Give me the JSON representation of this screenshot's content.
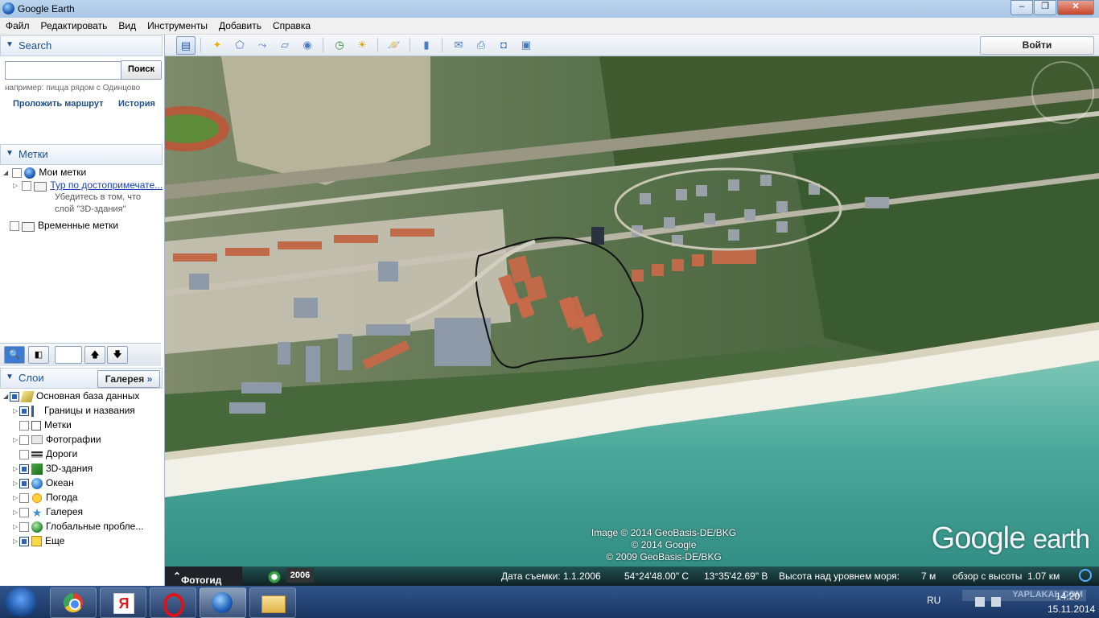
{
  "window": {
    "title": "Google Earth",
    "buttons": {
      "minimize": "–",
      "maximize": "❐",
      "close": "✕"
    }
  },
  "menu": [
    "Файл",
    "Редактировать",
    "Вид",
    "Инструменты",
    "Добавить",
    "Справка"
  ],
  "search": {
    "header": "Search",
    "button": "Поиск",
    "hint": "например: пицца рядом с Одинцово",
    "route_link": "Проложить маршрут",
    "history_link": "История"
  },
  "places": {
    "header": "Метки",
    "my_places": "Мои метки",
    "tour": "Тур по достопримечате...",
    "tour_note_1": "Убедитесь в том, что",
    "tour_note_2": "слой \"3D-здания\"",
    "temp_places": "Временные метки"
  },
  "layers": {
    "header": "Слои",
    "gallery_button": "Галерея",
    "items": [
      {
        "label": "Основная база данных",
        "checked": true,
        "icon": "layers-icon"
      },
      {
        "label": "Границы и названия",
        "checked": true,
        "icon": "borders-icon"
      },
      {
        "label": "Метки",
        "checked": false,
        "icon": "placemarks-icon"
      },
      {
        "label": "Фотографии",
        "checked": false,
        "icon": "photos-icon"
      },
      {
        "label": "Дороги",
        "checked": false,
        "icon": "roads-icon"
      },
      {
        "label": "3D-здания",
        "checked": true,
        "icon": "buildings-3d-icon"
      },
      {
        "label": "Океан",
        "checked": true,
        "icon": "ocean-icon"
      },
      {
        "label": "Погода",
        "checked": false,
        "icon": "weather-icon"
      },
      {
        "label": "Галерея",
        "checked": false,
        "icon": "gallery-icon"
      },
      {
        "label": "Глобальные пробле...",
        "checked": false,
        "icon": "global-awareness-icon"
      },
      {
        "label": "Еще",
        "checked": true,
        "icon": "more-icon"
      }
    ]
  },
  "toolbar": {
    "login": "Войти"
  },
  "map": {
    "attribution_1": "Image © 2014 GeoBasis-DE/BKG",
    "attribution_2": "© 2014 Google",
    "attribution_3": "© 2009 GeoBasis-DE/BKG",
    "logo_1": "Google",
    "logo_2": "earth"
  },
  "status": {
    "fotogid": "Фотогид",
    "year": "2006",
    "date": "Дата съемки: 1.1.2006",
    "lat": "54°24'48.00\" С",
    "lon": "13°35'42.69\" В",
    "elevation_label": "Высота над уровнем моря:",
    "elevation": "7 м",
    "eye_label": "обзор с высоты",
    "eye": "1.07 км"
  },
  "taskbar": {
    "lang": "RU",
    "time": "14:20",
    "date": "15.11.2014",
    "watermark": "YAPLAKAL.COM"
  },
  "colors": {
    "accent": "#1c4f8c",
    "sea": "#4aa89a",
    "sand": "#f2f1e8",
    "forest": "#3e5a2e"
  }
}
